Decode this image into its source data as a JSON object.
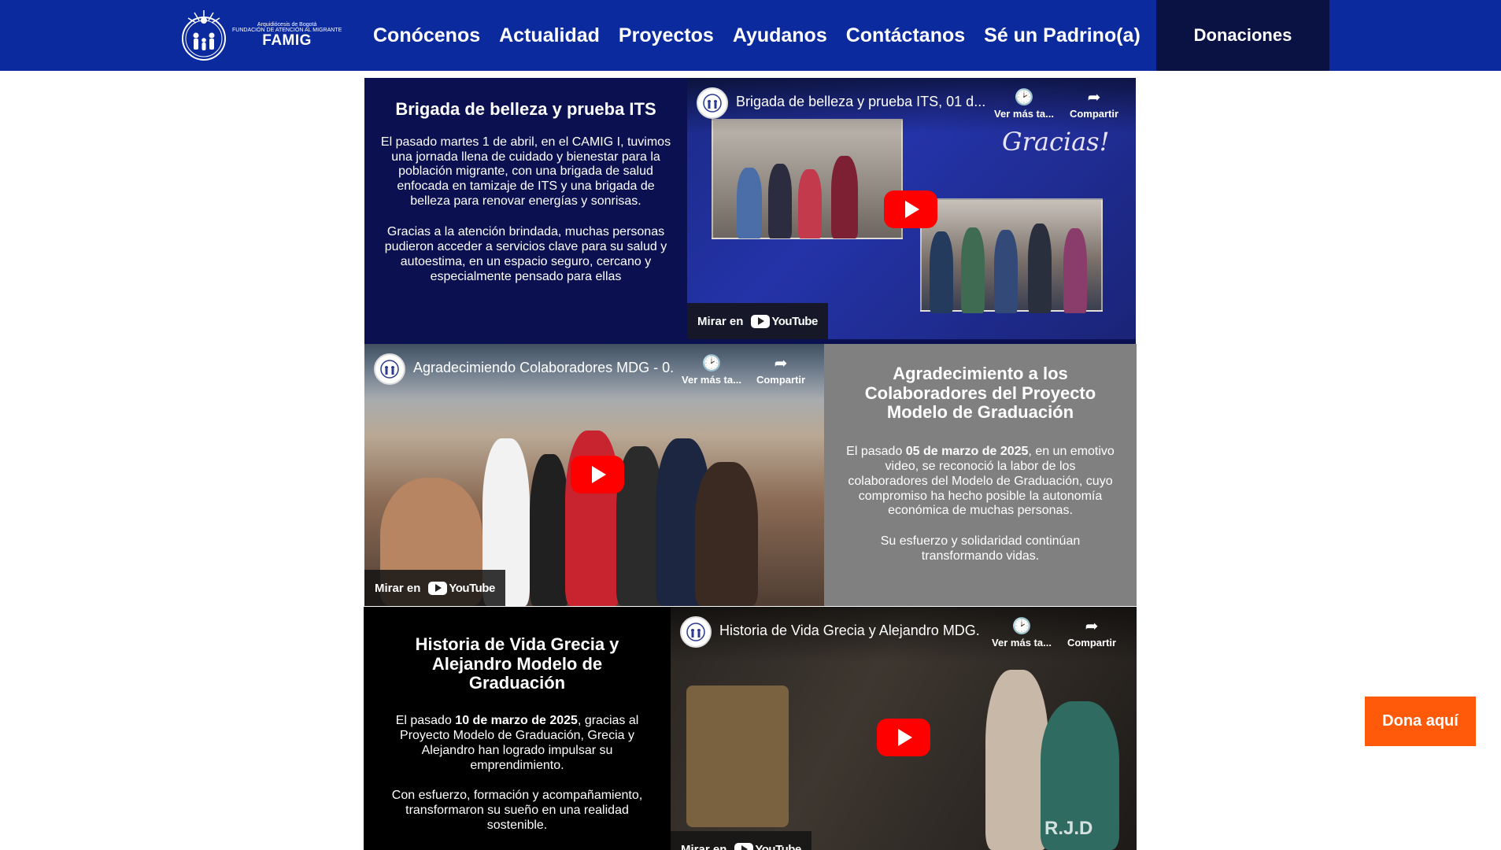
{
  "header": {
    "logo": {
      "line1": "Arquidiócesis de Bogotá",
      "line2": "FUNDACIÓN DE ATENCIÓN AL MIGRANTE",
      "line3": "FAMIG"
    },
    "nav": [
      "Conócenos",
      "Actualidad",
      "Proyectos",
      "Ayudanos",
      "Contáctanos",
      "Sé un Padrino(a)"
    ],
    "donate_label": "Donaciones"
  },
  "posts": [
    {
      "title": "Brigada de belleza y prueba ITS",
      "body": "El pasado martes 1 de abril, en el CAMIG I, tuvimos una jornada llena de cuidado y bienestar para la población migrante, con una brigada de salud enfocada en tamizaje de ITS y una brigada de belleza  para renovar energías y sonrisas.",
      "body2": "Gracias a la atención brindada, muchas personas pudieron acceder a servicios clave para su salud y autoestima, en un espacio seguro, cercano y especialmente pensado para ellas",
      "video": {
        "title": "Brigada de belleza y prueba ITS, 01 d...",
        "overlay_text": "Gracias!"
      }
    },
    {
      "title": "Agradecimiento a los Colaboradores del Proyecto Modelo de Graduación",
      "body_pre": "El pasado ",
      "body_bold": "05 de marzo de 2025",
      "body_post": ", en un emotivo video, se reconoció la labor de los colaboradores del Modelo de Graduación, cuyo compromiso ha hecho posible la autonomía económica de muchas personas.",
      "body2": "Su esfuerzo y solidaridad continúan transformando vidas.",
      "video": {
        "title": "Agradecimiendo Colaboradores MDG - 0..."
      }
    },
    {
      "title": "Historia de Vida Grecia y Alejandro Modelo de Graduación",
      "body_pre": "El pasado ",
      "body_bold": "10 de marzo de 2025",
      "body_post": ", gracias al Proyecto Modelo de Graduación, Grecia y Alejandro han logrado impulsar su emprendimiento.",
      "body2": "Con esfuerzo, formación y acompañamiento, transformaron su sueño en una realidad sostenible.",
      "video": {
        "title": "Historia de Vida Grecia y Alejandro MDG...",
        "watermark": "R.J.D"
      }
    }
  ],
  "video_ui": {
    "watch_later": "Ver más ta...",
    "share": "Compartir",
    "watch_on": "Mirar en",
    "youtube": "YouTube"
  },
  "floating_button": "Dona aquí",
  "colors": {
    "header_bg": "#0b2a9e",
    "donate_bg": "#0a1244",
    "post1_bg": "#0b1150",
    "post2_bg": "#808080",
    "post3_bg": "#000000",
    "floating_bg": "#ff5a0a"
  }
}
